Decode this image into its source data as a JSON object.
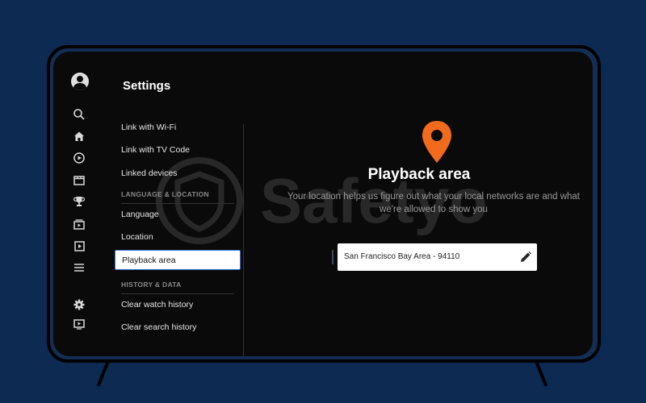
{
  "settings": {
    "title": "Settings",
    "menu": [
      {
        "label": "Link with Wi-Fi"
      },
      {
        "label": "Link with TV Code"
      },
      {
        "label": "Linked devices"
      }
    ],
    "section_language": "LANGUAGE & LOCATION",
    "menu_language": [
      {
        "label": "Language"
      },
      {
        "label": "Location"
      },
      {
        "label": "Playback area",
        "active": true
      }
    ],
    "section_history": "HISTORY & DATA",
    "menu_history": [
      {
        "label": "Clear watch history"
      },
      {
        "label": "Clear search history"
      }
    ]
  },
  "pane": {
    "title": "Playback area",
    "description": "Your location helps us figure out what your local networks are and what we're allowed to show you",
    "location_value": "San Francisco Bay Area - 94110"
  },
  "rail_icons": [
    "avatar-icon",
    "search-icon",
    "home-icon",
    "shorts-icon",
    "subscriptions-icon",
    "trophy-icon",
    "library-icon",
    "playlist-icon",
    "menu-icon",
    "gear-icon",
    "cast-icon"
  ],
  "watermark": "Safetyo",
  "colors": {
    "background": "#0c2a52",
    "screen": "#0a0a0a",
    "pin": "#f26b1d",
    "active_border": "#3d6fd8"
  }
}
